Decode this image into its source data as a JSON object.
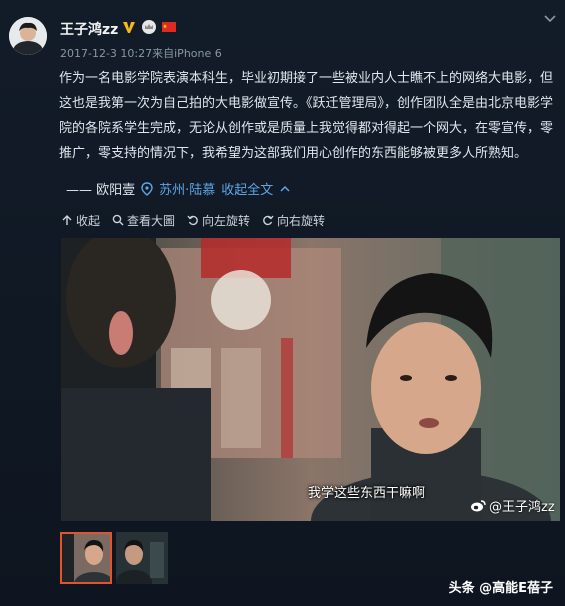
{
  "post": {
    "username": "王子鸿zz",
    "meta": "2017-12-3 10:27来自iPhone 6",
    "body": "作为一名电影学院表演本科生，毕业初期接了一些被业内人士瞧不上的网络大电影，但这也是我第一次为自己拍的大电影做宣传。《跃迁管理局》，创作团队全是由北京电影学院的各院系学生完成，无论从创作或是质量上我觉得都对得起一个网大，在零宣传，零推广，零支持的情况下，我希望为这部我们用心创作的东西能够被更多人所熟知。",
    "signature": "—— 欧阳壹",
    "location": "苏州·陆慕",
    "collapse_label": "收起全文"
  },
  "toolbar": {
    "collapse": "收起",
    "view_large": "查看大圖",
    "rotate_left": "向左旋转",
    "rotate_right": "向右旋转"
  },
  "photo": {
    "subtitle": "我学这些东西干嘛啊",
    "watermark": "@王子鸿zz"
  },
  "footer": {
    "source": "头条 @高能E蓓子"
  },
  "colors": {
    "background": "#0f1620",
    "link": "#5ea6e6",
    "active_thumb": "#e2552a"
  }
}
